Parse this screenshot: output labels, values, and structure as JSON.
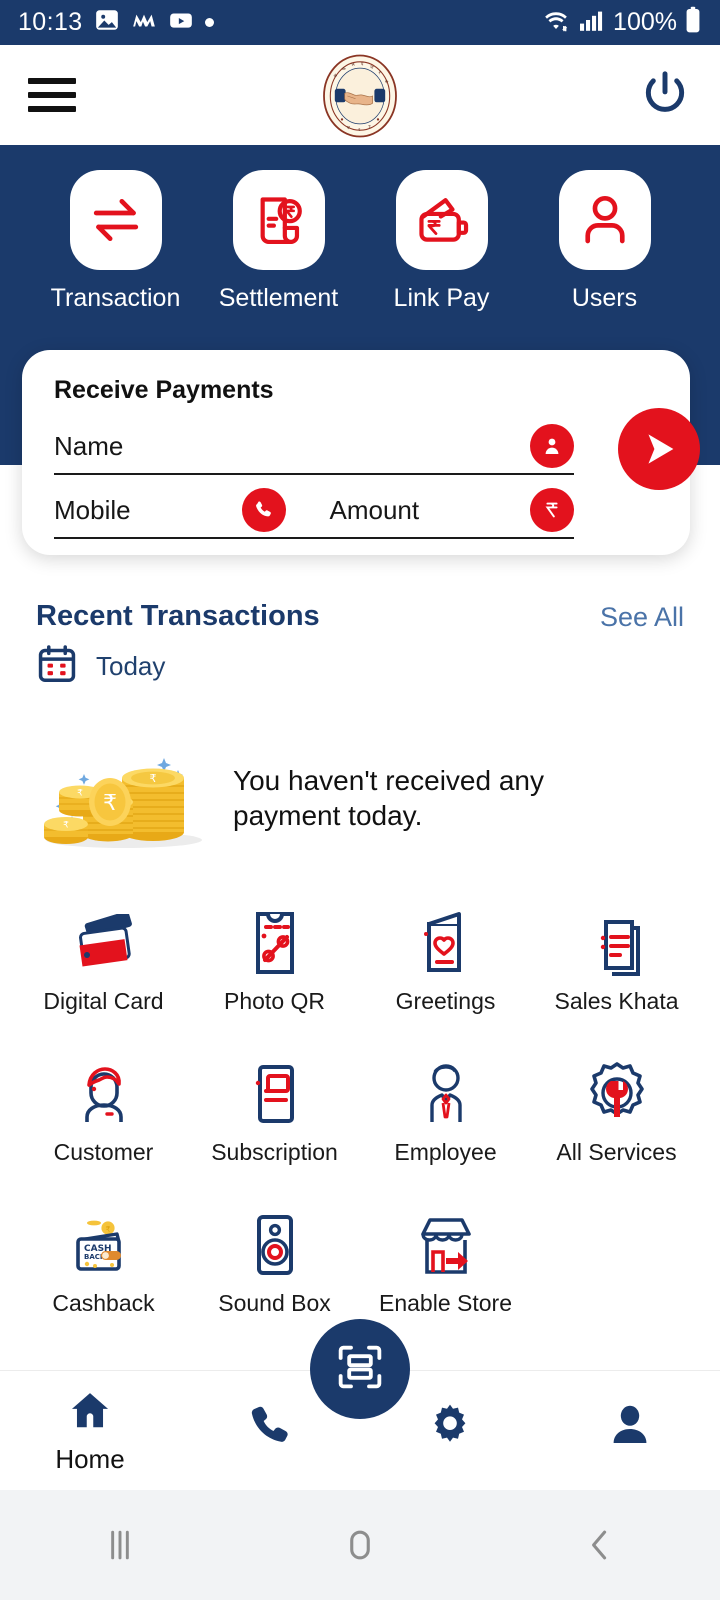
{
  "status_bar": {
    "time": "10:13",
    "battery_percent": "100%",
    "icons": [
      "gallery-icon",
      "m-app-icon",
      "youtube-icon",
      "dot-icon"
    ],
    "right_icons": [
      "wifi-icon",
      "signal-icon",
      "battery-icon"
    ]
  },
  "app_bar": {
    "menu_icon": "hamburger-icon",
    "logo": "cooperative-bank-handshake-logo",
    "power_icon": "power-icon"
  },
  "quick_actions": [
    {
      "label": "Transaction",
      "icon": "transfer-arrows-icon"
    },
    {
      "label": "Settlement",
      "icon": "document-rupee-icon"
    },
    {
      "label": "Link Pay",
      "icon": "wallet-rupee-icon"
    },
    {
      "label": "Users",
      "icon": "person-icon"
    }
  ],
  "receive_payments": {
    "title": "Receive Payments",
    "name_placeholder": "Name",
    "mobile_placeholder": "Mobile",
    "amount_placeholder": "Amount",
    "name_value": "",
    "mobile_value": "",
    "amount_value": "",
    "name_icon": "contact-icon",
    "mobile_icon": "phone-icon",
    "amount_icon": "rupee-icon",
    "send_icon": "send-arrow-icon"
  },
  "recent_transactions": {
    "title": "Recent Transactions",
    "see_all": "See All",
    "date_filter": "Today",
    "calendar_icon": "calendar-icon",
    "empty_message": "You haven't received any payment today.",
    "empty_illustration": "gold-coins-icon"
  },
  "services": [
    {
      "label": "Digital Card",
      "icon": "credit-cards-icon"
    },
    {
      "label": "Photo QR",
      "icon": "coupon-percent-icon"
    },
    {
      "label": "Greetings",
      "icon": "greeting-card-heart-icon"
    },
    {
      "label": "Sales Khata",
      "icon": "documents-stack-icon"
    },
    {
      "label": "Customer",
      "icon": "customer-person-icon"
    },
    {
      "label": "Subscription",
      "icon": "subscription-card-icon"
    },
    {
      "label": "Employee",
      "icon": "employee-tie-icon"
    },
    {
      "label": "All Services",
      "icon": "gear-wrench-icon"
    },
    {
      "label": "Cashback",
      "icon": "cashback-wallet-icon"
    },
    {
      "label": "Sound Box",
      "icon": "speaker-icon"
    },
    {
      "label": "Enable Store",
      "icon": "storefront-arrow-icon"
    }
  ],
  "bottom_nav": {
    "items": [
      {
        "label": "Home",
        "icon": "home-icon",
        "active": true
      },
      {
        "label": "",
        "icon": "phone-icon",
        "active": false
      },
      {
        "label": "",
        "icon": "settings-gear-icon",
        "active": false
      },
      {
        "label": "",
        "icon": "profile-icon",
        "active": false
      }
    ],
    "fab_icon": "qr-scan-icon"
  },
  "android_nav": {
    "recents": "recents-icon",
    "home": "home-circle-icon",
    "back": "back-chevron-icon"
  },
  "colors": {
    "navy": "#1b3a6b",
    "red": "#e3121d",
    "link_blue": "#4a73a8",
    "gold": "#f5c33b"
  }
}
